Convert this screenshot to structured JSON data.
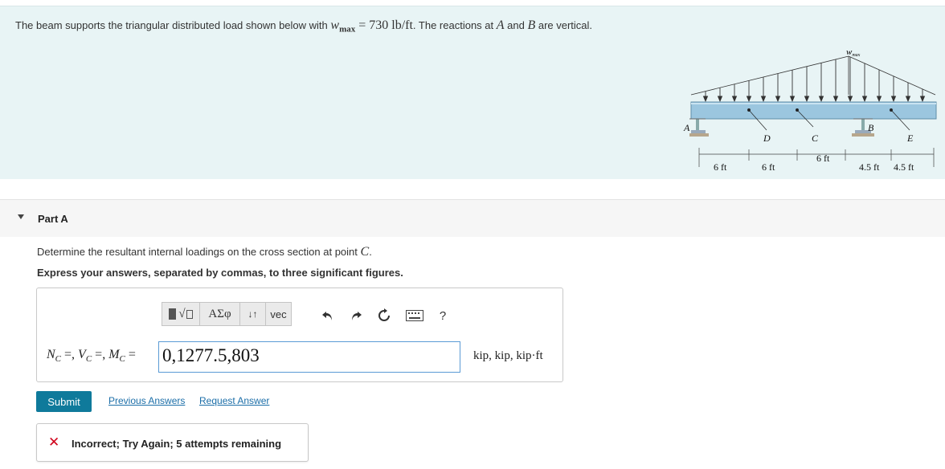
{
  "problem": {
    "text_before": "The beam supports the triangular distributed load shown below with ",
    "wmax_symbol": "w",
    "wmax_sub": "max",
    "equals_value": " = 730 lb/ft",
    "text_after": ". The reactions at ",
    "point_a": "A",
    "and": " and ",
    "point_b": "B",
    "text_end": " are vertical."
  },
  "figure": {
    "load_label": "w",
    "load_label_sub": "max",
    "labels": {
      "a": "A",
      "d": "D",
      "c": "C",
      "b": "B",
      "e": "E"
    },
    "dims": [
      "6 ft",
      "6 ft",
      "6 ft",
      "4.5 ft",
      "4.5 ft"
    ]
  },
  "part": {
    "title": "Part A"
  },
  "question": {
    "text": "Determine the resultant internal loadings on the cross section at point ",
    "point": "C",
    "end": ".",
    "instruction": "Express your answers, separated by commas, to three significant figures."
  },
  "toolbar": {
    "templates_label": "√",
    "greek_label": "ΑΣφ",
    "arrows_label": "↓↑",
    "vec_label": "vec",
    "help_label": "?"
  },
  "answer": {
    "label": "N",
    "label_full": "NC =, VC =, MC =",
    "value": "0,1277.5,803",
    "units": "kip, kip, kip·ft"
  },
  "actions": {
    "submit_label": "Submit",
    "previous_answers": "Previous Answers",
    "request_answer": "Request Answer"
  },
  "feedback": {
    "icon": "✕",
    "message": "Incorrect; Try Again; 5 attempts remaining"
  },
  "colors": {
    "problem_bg": "#e8f4f5",
    "submit_bg": "#0f7a9b",
    "link": "#1b6ea8",
    "error": "#d0021b",
    "beam": "#9bc6df"
  }
}
